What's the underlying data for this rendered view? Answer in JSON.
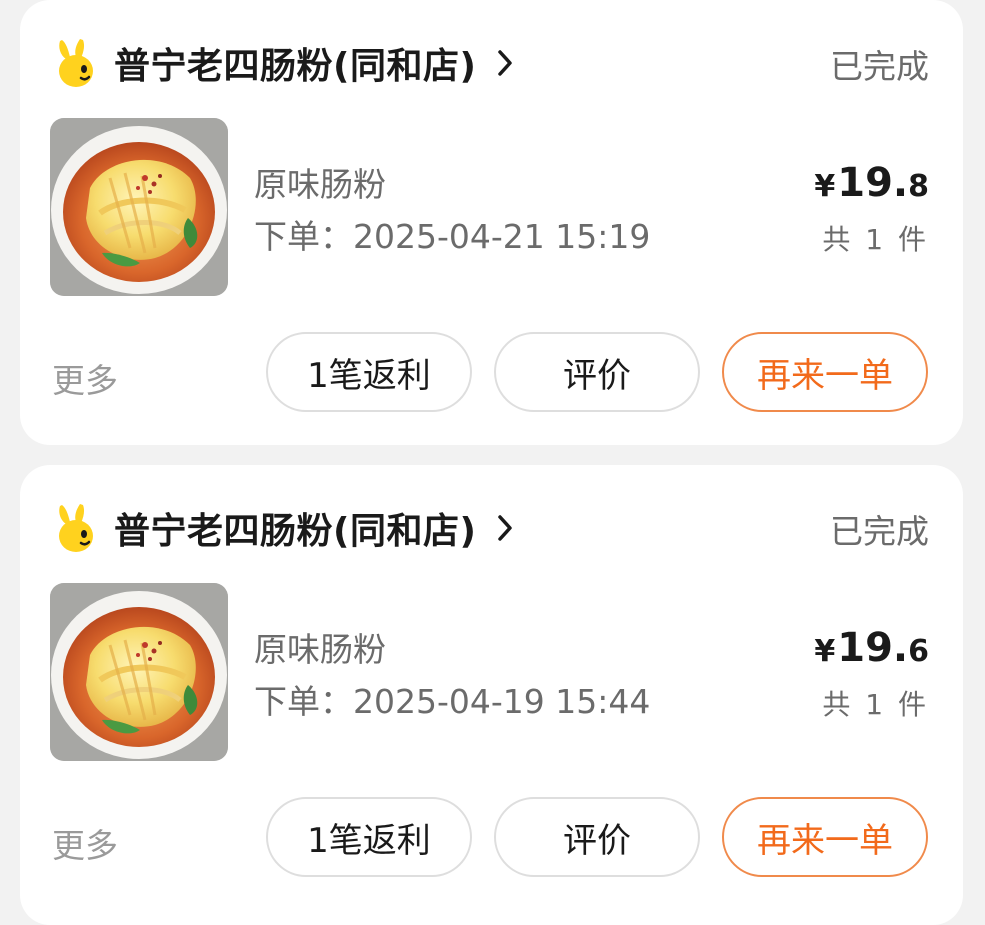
{
  "orders": [
    {
      "shop_name": "普宁老四肠粉(同和店)",
      "status": "已完成",
      "item_name": "原味肠粉",
      "order_time_label": "下单：",
      "order_time": "2025-04-21 15:19",
      "price_symbol": "¥",
      "price_int": "19.",
      "price_dec": "8",
      "quantity": "共 1 件",
      "more_label": "更多",
      "rebate_button": "1笔返利",
      "review_button": "评价",
      "reorder_button": "再来一单"
    },
    {
      "shop_name": "普宁老四肠粉(同和店)",
      "status": "已完成",
      "item_name": "原味肠粉",
      "order_time_label": "下单：",
      "order_time": "2025-04-19 15:44",
      "price_symbol": "¥",
      "price_int": "19.",
      "price_dec": "6",
      "quantity": "共 1 件",
      "more_label": "更多",
      "rebate_button": "1笔返利",
      "review_button": "评价",
      "reorder_button": "再来一单"
    }
  ],
  "icons": {
    "shop_logo": "bunny-logo-icon",
    "chevron": "chevron-right-icon",
    "food_image": "rice-noodle-roll-photo"
  },
  "colors": {
    "accent": "#f26a1b",
    "accent_border": "#f08a4b",
    "logo_yellow": "#ffd21e",
    "text_primary": "#1a1a1a",
    "text_secondary": "#6b6b6b",
    "text_muted": "#9a9a9a"
  }
}
